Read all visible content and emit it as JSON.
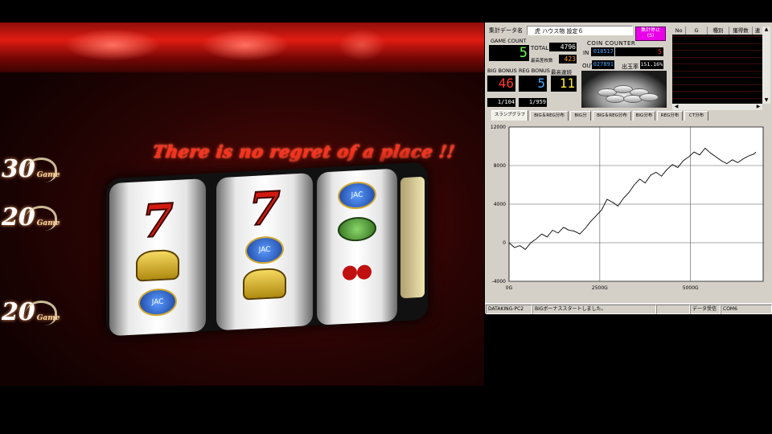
{
  "machine": {
    "tagline": "There is no regret of a place !!",
    "badges": [
      {
        "num": "30",
        "suffix": "Game"
      },
      {
        "num": "20",
        "suffix": "Game"
      },
      {
        "num": "20",
        "suffix": "Game"
      }
    ],
    "reel_symbols": [
      "7",
      "7"
    ],
    "jac_label": "JAC"
  },
  "panel": {
    "data_name_label": "集計データ名",
    "data_name_value": " 虎 ハウス物 設定６",
    "stop_button": "集計停止\n(S)",
    "game_count_label": "GAME COUNT",
    "game_count": "5",
    "total_label": "TOTAL",
    "total": "4796",
    "max_hold_label": "最高差枚数",
    "max_hold": "423",
    "coin_counter_label": "COIN COUNTER",
    "in_label": "IN",
    "in_value": "018517",
    "in_right": "5",
    "out_label": "OUT",
    "out_value": "027891",
    "payout_label": "出玉率",
    "payout_value": "151.16%",
    "big_label": "BIG BONUS",
    "big_count": "46",
    "reg_label": "REG BONUS",
    "reg_count": "5",
    "streak_label": "最高連続",
    "streak": "11",
    "big_prob": "1/104",
    "reg_prob": "1/959",
    "list_headers": [
      "No",
      "G",
      "種別",
      "獲得数",
      "連"
    ],
    "tabs": [
      "スランプグラフ",
      "BIG＆REG分布",
      "BIG分",
      "BIG＆REG分布",
      "BIG分布",
      "REG分布",
      "CT分布"
    ],
    "status": [
      "DATAKING-PC2",
      "BIGボーナススタートしました。",
      "",
      "データ受信",
      "COM6"
    ]
  },
  "chart_data": {
    "type": "line",
    "title": "",
    "xlabel": "",
    "ylabel": "",
    "x_ticks": [
      "0G",
      "2500G",
      "5000G"
    ],
    "y_ticks": [
      "12000",
      "8000",
      "4000",
      "0",
      "-4000"
    ],
    "xlim": [
      0,
      7000
    ],
    "ylim": [
      -4000,
      12000
    ],
    "grid": true,
    "series": [
      {
        "x": [
          0,
          150,
          300,
          450,
          600,
          750,
          900,
          1050,
          1200,
          1350,
          1500,
          1650,
          1800,
          1950,
          2100,
          2250,
          2400,
          2550,
          2700,
          2850,
          3000,
          3150,
          3300,
          3450,
          3600,
          3750,
          3900,
          4050,
          4200,
          4350,
          4500,
          4650,
          4800,
          4950,
          5100,
          5250,
          5400,
          5550,
          5700,
          5850,
          6000,
          6150,
          6300,
          6450,
          6600,
          6750,
          6800
        ],
        "values": [
          0,
          -500,
          -300,
          -700,
          0,
          400,
          900,
          600,
          1300,
          1000,
          1600,
          1300,
          1200,
          900,
          1500,
          2200,
          2800,
          3400,
          4500,
          4200,
          3800,
          4600,
          5200,
          6000,
          6600,
          6200,
          7000,
          7300,
          6900,
          7600,
          8100,
          7800,
          8500,
          8900,
          9400,
          9100,
          9800,
          9300,
          8900,
          8500,
          8200,
          8600,
          8300,
          8700,
          9000,
          9200,
          9400
        ]
      }
    ]
  }
}
